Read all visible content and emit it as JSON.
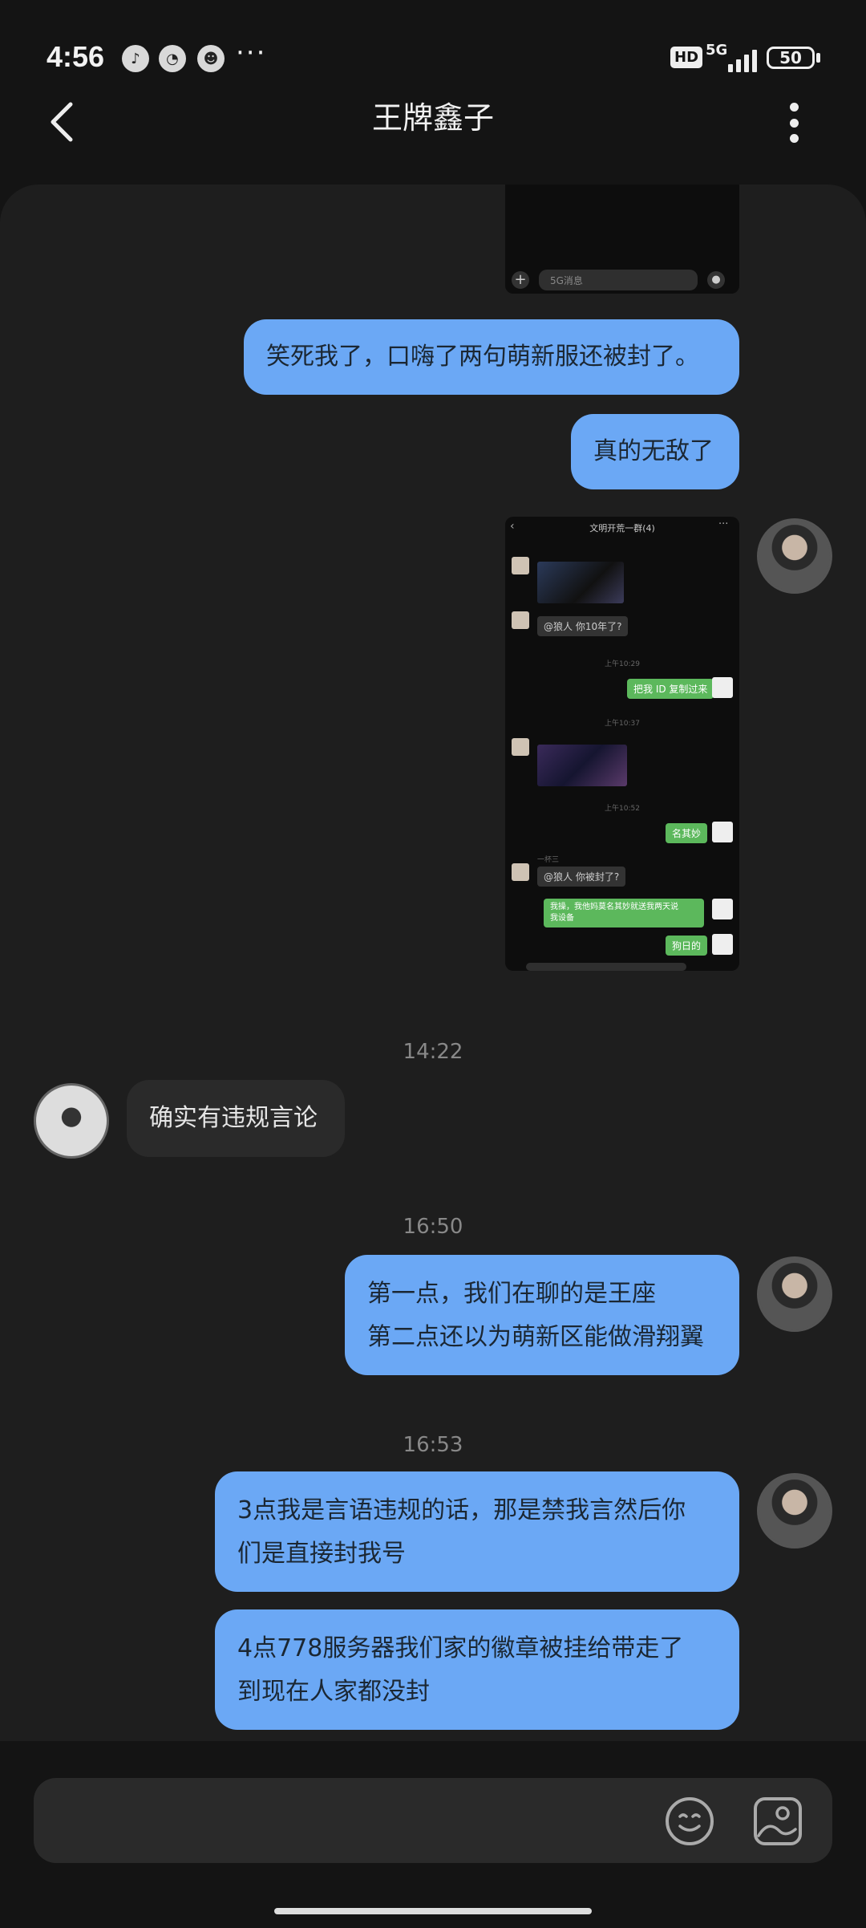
{
  "status_bar": {
    "time": "4:56",
    "app_icons": [
      "douyin-icon",
      "chat-bubble-icon",
      "game-icon"
    ],
    "more": "···",
    "hd": "HD",
    "network": "5G",
    "battery": "50"
  },
  "header": {
    "title": "王牌鑫子"
  },
  "messages": {
    "m1": "笑死我了，口嗨了两句萌新服还被封了。",
    "m2": "真的无敌了",
    "ts1": "14:22",
    "other1": "确实有违规言论",
    "ts2": "16:50",
    "m3_line1": "第一点，我们在聊的是王座",
    "m3_line2": "第二点还以为萌新区能做滑翔翼",
    "ts3": "16:53",
    "m4_line1": "3点我是言语违规的话，那是禁我言然后你",
    "m4_line2": "们是直接封我号",
    "m5_line1": "4点778服务器我们家的徽章被挂给带走了",
    "m5_line2": "到现在人家都没封"
  },
  "thumb1": {
    "input_placeholder": "5G消息"
  },
  "thumb2": {
    "title": "文明开荒一群(4)",
    "msg_q1": "@狼人 你10年了?",
    "time_a": "上午10:29",
    "msg_g1": "把我 ID 复制过来",
    "time_b": "上午10:37",
    "time_c": "上午10:52",
    "msg_g2": "名其妙",
    "sender": "一杯三",
    "msg_q2": "@狼人 你被封了?",
    "msg_g3_l1": "我操，我他妈莫名其妙就送我两天说",
    "msg_g3_l2": "我设备",
    "msg_g4": "狗日的"
  },
  "input_bar": {
    "emoji": "emoji-icon",
    "image": "image-icon"
  }
}
